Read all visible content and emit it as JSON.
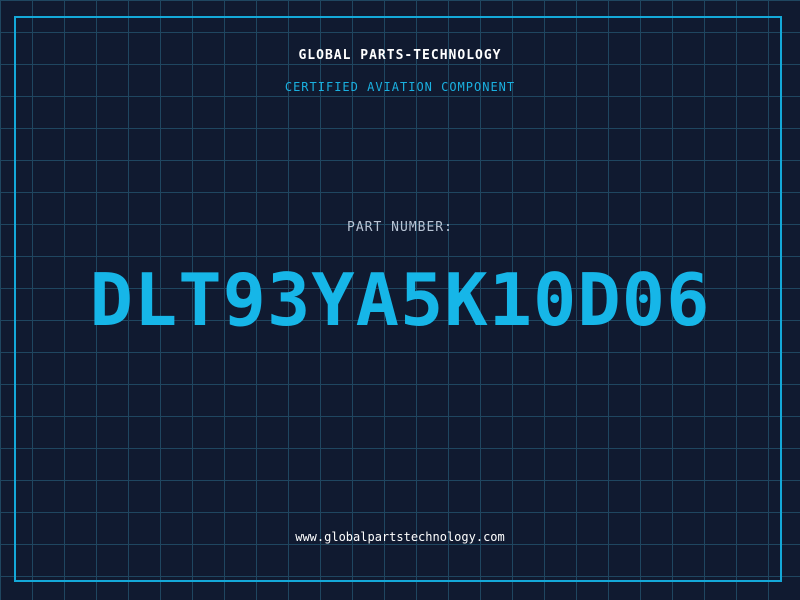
{
  "header": {
    "company_name": "GLOBAL PARTS-TECHNOLOGY",
    "subtitle": "CERTIFIED AVIATION COMPONENT"
  },
  "part": {
    "label": "PART NUMBER:",
    "number": "DLT93YA5K10D06"
  },
  "footer": {
    "website": "www.globalpartstechnology.com"
  },
  "colors": {
    "background": "#101a30",
    "grid": "#1f4660",
    "accent": "#16b6e8",
    "text_primary": "#ffffff",
    "text_muted": "#b8c4d4"
  }
}
